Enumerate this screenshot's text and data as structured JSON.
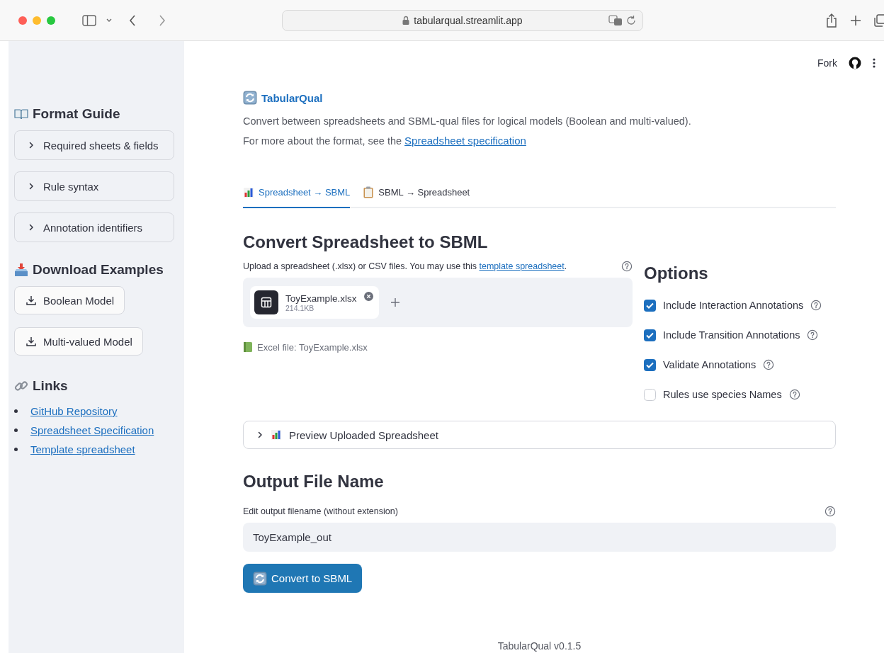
{
  "browser": {
    "url": "tabularqual.streamlit.app"
  },
  "header": {
    "fork_label": "Fork"
  },
  "sidebar": {
    "format_guide": {
      "title": "Format Guide",
      "expanders": [
        {
          "label": "Required sheets & fields",
          "expanded": false
        },
        {
          "label": "Rule syntax",
          "expanded": false
        },
        {
          "label": "Annotation identifiers",
          "expanded": false
        }
      ]
    },
    "downloads": {
      "title": "Download Examples",
      "buttons": [
        "Boolean Model",
        "Multi-valued Model"
      ]
    },
    "links": {
      "title": "Links",
      "items": [
        "GitHub Repository",
        "Spreadsheet Specification",
        "Template spreadsheet"
      ]
    }
  },
  "main": {
    "app_title": "TabularQual",
    "description": "Convert between spreadsheets and SBML-qual files for logical models (Boolean and multi-valued).",
    "more_text": "For more about the format, see the ",
    "more_link": "Spreadsheet specification",
    "tabs": [
      {
        "label": "Spreadsheet → SBML",
        "kind": "chart",
        "selected": true
      },
      {
        "label": "SBML → Spreadsheet",
        "kind": "clipboard",
        "selected": false
      }
    ],
    "converter": {
      "heading": "Convert Spreadsheet to SBML",
      "upload_label": "Upload a spreadsheet (.xlsx) or CSV files. You may use this ",
      "upload_link": "template spreadsheet",
      "upload_label_end": ".",
      "file": {
        "name": "ToyExample.xlsx",
        "size": "214.1KB"
      },
      "excel_info": "Excel file: ToyExample.xlsx"
    },
    "options": {
      "heading": "Options",
      "items": [
        {
          "label": "Include Interaction Annotations",
          "checked": true
        },
        {
          "label": "Include Transition Annotations",
          "checked": true
        },
        {
          "label": "Validate Annotations",
          "checked": true
        },
        {
          "label": "Rules use species Names",
          "checked": false
        }
      ]
    },
    "preview": {
      "label": "Preview Uploaded Spreadsheet",
      "expanded": false
    },
    "output": {
      "heading": "Output File Name",
      "field_label": "Edit output filename (without extension)",
      "value": "ToyExample_out"
    },
    "convert_button": "Convert to SBML",
    "footer": "TabularQual v0.1.5"
  }
}
